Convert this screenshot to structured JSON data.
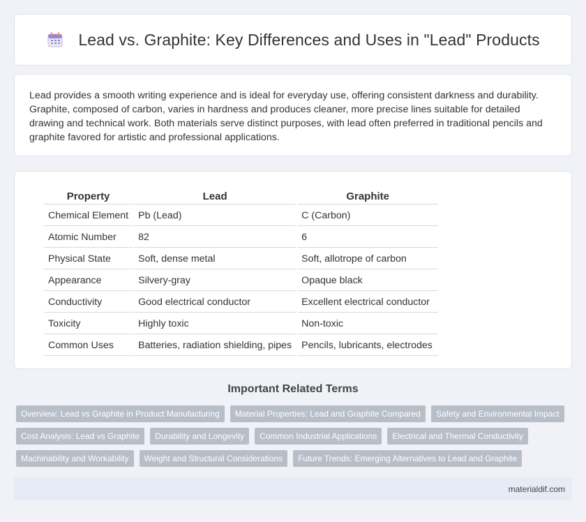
{
  "header": {
    "title": "Lead vs. Graphite: Key Differences and Uses in \"Lead\" Products",
    "icon": "calendar-icon"
  },
  "intro": {
    "text": "Lead provides a smooth writing experience and is ideal for everyday use, offering consistent darkness and durability. Graphite, composed of carbon, varies in hardness and produces cleaner, more precise lines suitable for detailed drawing and technical work. Both materials serve distinct purposes, with lead often preferred in traditional pencils and graphite favored for artistic and professional applications."
  },
  "table": {
    "headers": [
      "Property",
      "Lead",
      "Graphite"
    ],
    "rows": [
      [
        "Chemical Element",
        "Pb (Lead)",
        "C (Carbon)"
      ],
      [
        "Atomic Number",
        "82",
        "6"
      ],
      [
        "Physical State",
        "Soft, dense metal",
        "Soft, allotrope of carbon"
      ],
      [
        "Appearance",
        "Silvery-gray",
        "Opaque black"
      ],
      [
        "Conductivity",
        "Good electrical conductor",
        "Excellent electrical conductor"
      ],
      [
        "Toxicity",
        "Highly toxic",
        "Non-toxic"
      ],
      [
        "Common Uses",
        "Batteries, radiation shielding, pipes",
        "Pencils, lubricants, electrodes"
      ]
    ]
  },
  "related": {
    "title": "Important Related Terms",
    "rows": [
      [
        "Overview: Lead vs Graphite in Product Manufacturing",
        "Material Properties: Lead and Graphite Compared",
        "Safety and Environmental Impact"
      ],
      [
        "Cost Analysis: Lead vs Graphite",
        "Durability and Longevity",
        "Common Industrial Applications",
        "Electrical and Thermal Conductivity"
      ],
      [
        "Machinability and Workability",
        "Weight and Structural Considerations",
        "Future Trends: Emerging Alternatives to Lead and Graphite"
      ]
    ]
  },
  "footer": {
    "text": "materialdif.com"
  }
}
